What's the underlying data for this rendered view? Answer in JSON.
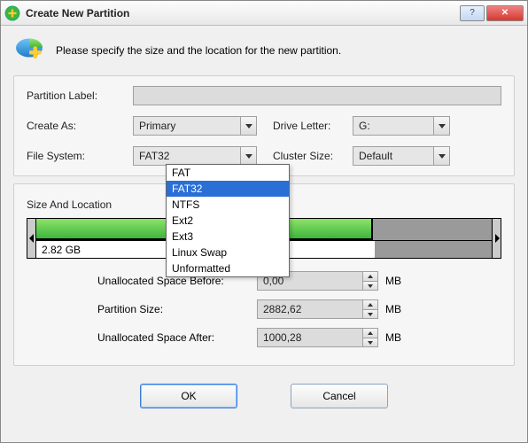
{
  "window": {
    "title": "Create New Partition"
  },
  "header": {
    "instruction": "Please specify the size and the location for the new partition."
  },
  "form": {
    "partition_label_lbl": "Partition Label:",
    "partition_label_val": "",
    "create_as_lbl": "Create As:",
    "create_as_val": "Primary",
    "drive_letter_lbl": "Drive Letter:",
    "drive_letter_val": "G:",
    "file_system_lbl": "File System:",
    "file_system_val": "FAT32",
    "cluster_size_lbl": "Cluster Size:",
    "cluster_size_val": "Default"
  },
  "fs_options": [
    "FAT",
    "FAT32",
    "NTFS",
    "Ext2",
    "Ext3",
    "Linux Swap",
    "Unformatted"
  ],
  "fs_selected_index": 1,
  "size_section_label": "Size And Location",
  "bar": {
    "used_label": "2.82 GB",
    "green_pct": 74,
    "gray_pct": 26
  },
  "sizes": {
    "before_lbl": "Unallocated Space Before:",
    "before_val": "0,00",
    "partition_lbl": "Partition Size:",
    "partition_val": "2882,62",
    "after_lbl": "Unallocated Space After:",
    "after_val": "1000,28",
    "unit": "MB"
  },
  "buttons": {
    "ok": "OK",
    "cancel": "Cancel"
  },
  "colors": {
    "accent": "#2a6fd6",
    "green_a": "#8ee26a",
    "green_b": "#3db53d"
  }
}
